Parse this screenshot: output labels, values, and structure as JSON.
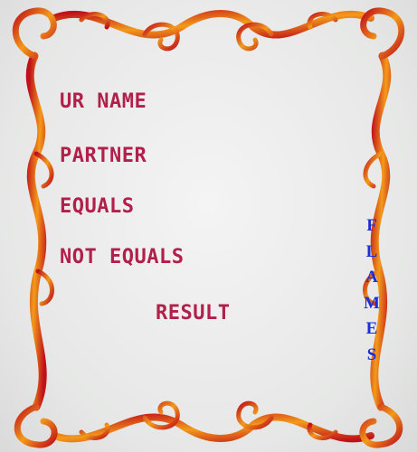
{
  "labels": {
    "name": "UR NAME",
    "partner": "PARTNER",
    "equals": "EQUALS",
    "not_equals": "NOT EQUALS"
  },
  "result_button": "RESULT",
  "flames": [
    "F",
    "L",
    "A",
    "M",
    "E",
    "S"
  ],
  "colors": {
    "label": "#b0204a",
    "flames": "#1a2fd8",
    "frame_outer": "#c0101a",
    "frame_inner": "#f39a1a"
  }
}
